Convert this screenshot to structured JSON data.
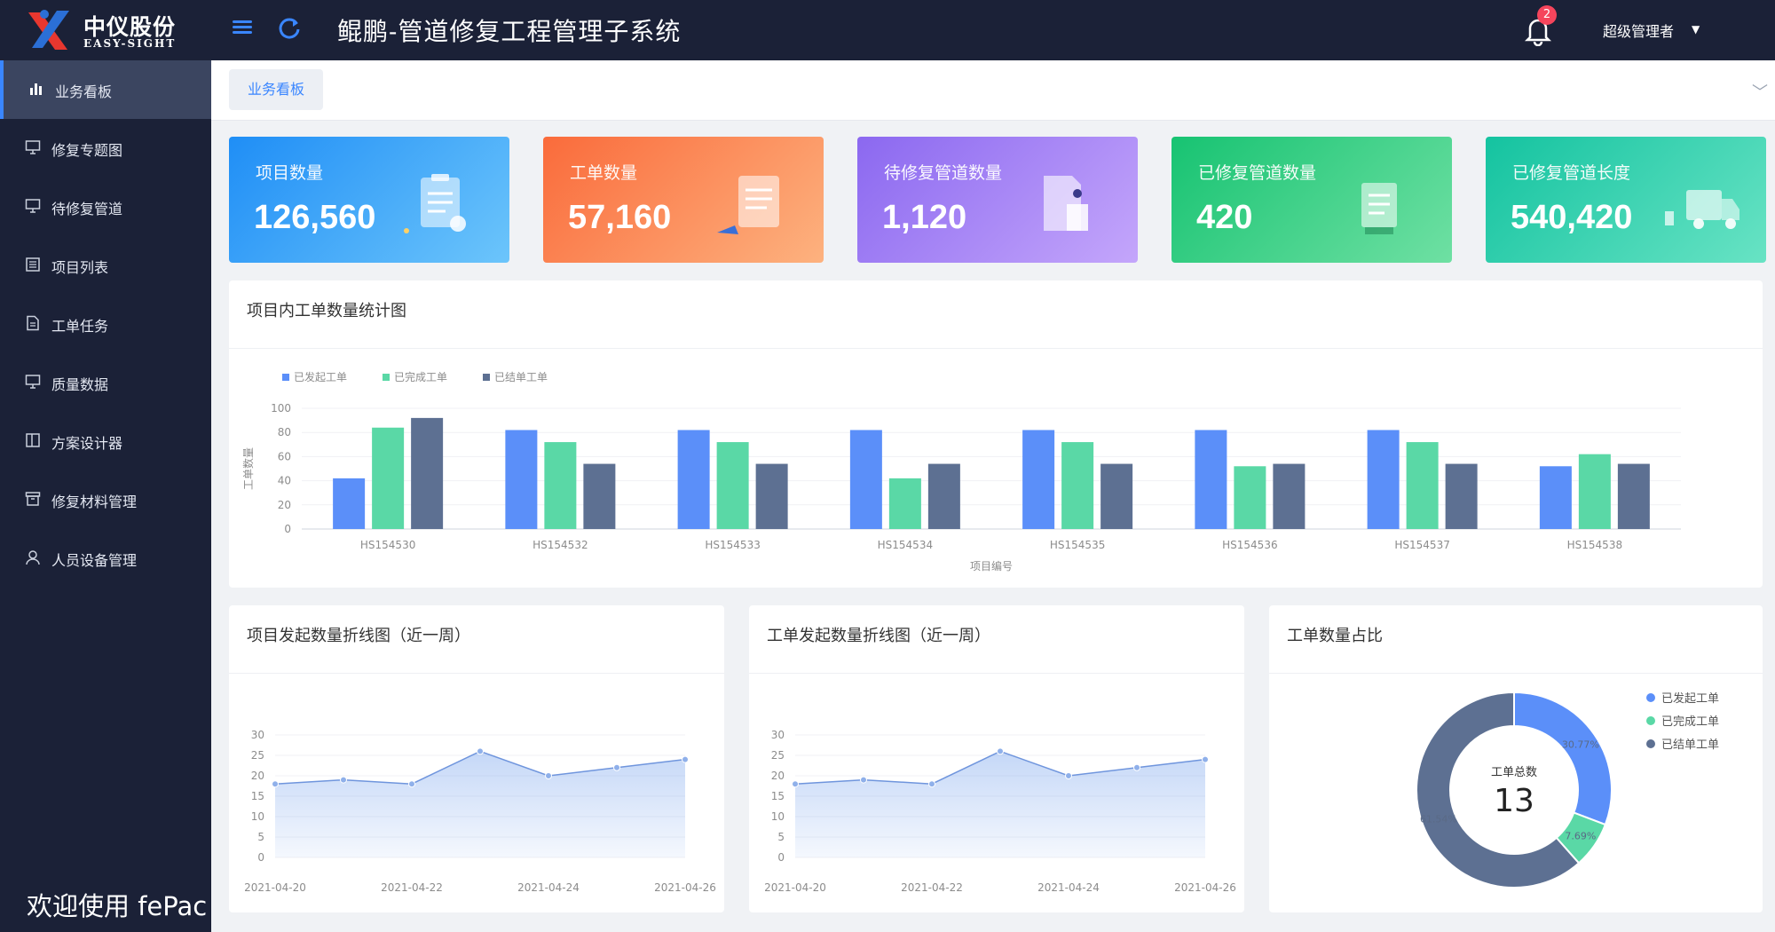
{
  "header": {
    "logo_cn": "中仪股份",
    "logo_en": "EASY-SIGHT",
    "title": "鲲鹏-管道修复工程管理子系统",
    "notification_count": "2",
    "user": "超级管理者"
  },
  "sidebar": {
    "items": [
      {
        "label": "业务看板",
        "icon": "bar-chart-icon"
      },
      {
        "label": "修复专题图",
        "icon": "monitor-icon"
      },
      {
        "label": "待修复管道",
        "icon": "monitor-icon"
      },
      {
        "label": "项目列表",
        "icon": "list-icon"
      },
      {
        "label": "工单任务",
        "icon": "document-icon"
      },
      {
        "label": "质量数据",
        "icon": "monitor-icon"
      },
      {
        "label": "方案设计器",
        "icon": "layout-icon"
      },
      {
        "label": "修复材料管理",
        "icon": "archive-icon"
      },
      {
        "label": "人员设备管理",
        "icon": "user-icon"
      }
    ],
    "active_index": 0
  },
  "welcome": "欢迎使用 fePac",
  "tabs": [
    {
      "label": "业务看板"
    }
  ],
  "cards": [
    {
      "title": "项目数量",
      "value": "126,560",
      "color_from": "#1f8ef6",
      "color_to": "#6cc5fb"
    },
    {
      "title": "工单数量",
      "value": "57,160",
      "color_from": "#fa6b3b",
      "color_to": "#fdb27f"
    },
    {
      "title": "待修复管道数量",
      "value": "1,120",
      "color_from": "#8b68f0",
      "color_to": "#c4a6fb"
    },
    {
      "title": "已修复管道数量",
      "value": "420",
      "color_from": "#17c372",
      "color_to": "#6fe0a3"
    },
    {
      "title": "已修复管道长度",
      "value": "540,420",
      "color_from": "#14c3a0",
      "color_to": "#68e3c4"
    }
  ],
  "bar_panel": {
    "title": "项目内工单数量统计图"
  },
  "line_panel_1": {
    "title": "项目发起数量折线图（近一周）"
  },
  "line_panel_2": {
    "title": "工单发起数量折线图（近一周）"
  },
  "donut_panel": {
    "title": "工单数量占比"
  },
  "chart_data": [
    {
      "type": "bar",
      "categories": [
        "HS154530",
        "HS154532",
        "HS154533",
        "HS154534",
        "HS154535",
        "HS154536",
        "HS154537",
        "HS154538"
      ],
      "series": [
        {
          "name": "已发起工单",
          "color": "#5b8ff9",
          "values": [
            42,
            82,
            82,
            82,
            82,
            82,
            82,
            52
          ]
        },
        {
          "name": "已完成工单",
          "color": "#5ad8a6",
          "values": [
            84,
            72,
            72,
            42,
            72,
            52,
            72,
            62
          ]
        },
        {
          "name": "已结单工单",
          "color": "#5d7092",
          "values": [
            92,
            54,
            54,
            54,
            54,
            54,
            54,
            54
          ]
        }
      ],
      "xlabel": "项目编号",
      "ylabel": "工单数量",
      "ylim": [
        0,
        100
      ],
      "yticks": [
        0,
        20,
        40,
        60,
        80,
        100
      ],
      "legend": "top-left"
    },
    {
      "type": "area",
      "x": [
        "2021-04-20",
        "2021-04-21",
        "2021-04-22",
        "2021-04-23",
        "2021-04-24",
        "2021-04-25",
        "2021-04-26"
      ],
      "xticks": [
        "2021-04-20",
        "2021-04-22",
        "2021-04-24",
        "2021-04-26"
      ],
      "values": [
        18,
        19,
        18,
        26,
        20,
        22,
        24
      ],
      "ylim": [
        0,
        30
      ],
      "yticks": [
        0,
        5,
        10,
        15,
        20,
        25,
        30
      ]
    },
    {
      "type": "area",
      "x": [
        "2021-04-20",
        "2021-04-21",
        "2021-04-22",
        "2021-04-23",
        "2021-04-24",
        "2021-04-25",
        "2021-04-26"
      ],
      "xticks": [
        "2021-04-20",
        "2021-04-22",
        "2021-04-24",
        "2021-04-26"
      ],
      "values": [
        18,
        19,
        18,
        26,
        20,
        22,
        24
      ],
      "ylim": [
        0,
        30
      ],
      "yticks": [
        0,
        5,
        10,
        15,
        20,
        25,
        30
      ]
    },
    {
      "type": "pie",
      "center_label": "工单总数",
      "center_value": "13",
      "slices": [
        {
          "name": "已发起工单",
          "value": 30.77,
          "label": "30.77%",
          "color": "#5b8ff9"
        },
        {
          "name": "已完成工单",
          "value": 7.69,
          "label": "7.69%",
          "color": "#5ad8a6"
        },
        {
          "name": "已结单工单",
          "value": 61.54,
          "label": "61.54%",
          "color": "#5d7092"
        }
      ],
      "legend": "top-right"
    }
  ]
}
